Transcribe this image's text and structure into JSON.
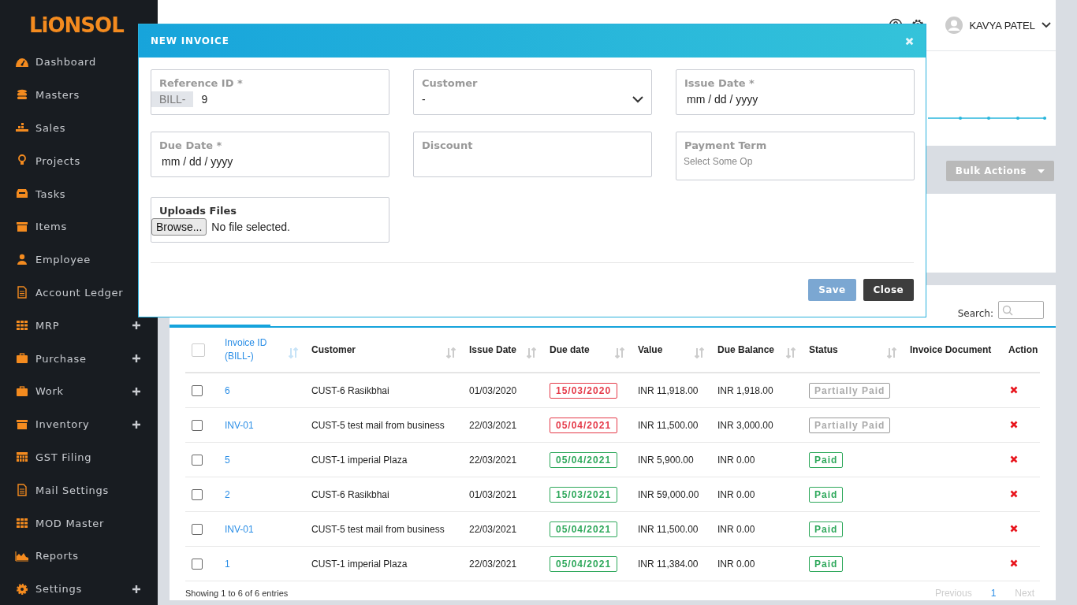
{
  "logo": "LiONSOL",
  "sidebar": {
    "items": [
      {
        "label": "Dashboard",
        "expandable": false
      },
      {
        "label": "Masters",
        "expandable": false
      },
      {
        "label": "Sales",
        "expandable": false
      },
      {
        "label": "Projects",
        "expandable": false
      },
      {
        "label": "Tasks",
        "expandable": false
      },
      {
        "label": "Items",
        "expandable": false
      },
      {
        "label": "Employee",
        "expandable": false
      },
      {
        "label": "Account Ledger",
        "expandable": false
      },
      {
        "label": "MRP",
        "expandable": true
      },
      {
        "label": "Purchase",
        "expandable": true
      },
      {
        "label": "Work",
        "expandable": true
      },
      {
        "label": "Inventory",
        "expandable": true
      },
      {
        "label": "GST Filing",
        "expandable": false
      },
      {
        "label": "Mail Settings",
        "expandable": false
      },
      {
        "label": "MOD Master",
        "expandable": false
      },
      {
        "label": "Reports",
        "expandable": false
      },
      {
        "label": "Settings",
        "expandable": true
      }
    ]
  },
  "header": {
    "user": "KAVYA PATEL"
  },
  "toolbar": {
    "bulk_actions": "Bulk Actions"
  },
  "table": {
    "search_label": "Search:",
    "columns": [
      {
        "label": "Invoice ID\n(BILL-)",
        "sortable": true,
        "link": true
      },
      {
        "label": "Customer",
        "sortable": true,
        "link": false
      },
      {
        "label": "Issue Date",
        "sortable": true,
        "link": false
      },
      {
        "label": "Due date",
        "sortable": true,
        "link": false
      },
      {
        "label": "Value",
        "sortable": true,
        "link": false
      },
      {
        "label": "Due Balance",
        "sortable": true,
        "link": false
      },
      {
        "label": "Status",
        "sortable": true,
        "link": false
      },
      {
        "label": "Invoice Document",
        "sortable": false,
        "link": false
      },
      {
        "label": "Action",
        "sortable": false,
        "link": false
      }
    ],
    "select_all_checked": false,
    "rows": [
      {
        "checked": false,
        "invoice_id": "6",
        "customer": "CUST-6 Rasikbhai",
        "issue_date": "01/03/2020",
        "due_date": "15/03/2020",
        "overdue": true,
        "value": "INR 11,918.00",
        "due_balance": "INR 1,918.00",
        "status": "Partially Paid",
        "paid": false
      },
      {
        "checked": false,
        "invoice_id": "INV-01",
        "customer": "CUST-5 test mail from business",
        "issue_date": "22/03/2021",
        "due_date": "05/04/2021",
        "overdue": true,
        "value": "INR 11,500.00",
        "due_balance": "INR 3,000.00",
        "status": "Partially Paid",
        "paid": false
      },
      {
        "checked": false,
        "invoice_id": "5",
        "customer": "CUST-1 imperial Plaza",
        "issue_date": "22/03/2021",
        "due_date": "05/04/2021",
        "overdue": false,
        "value": "INR 5,900.00",
        "due_balance": "INR 0.00",
        "status": "Paid",
        "paid": true
      },
      {
        "checked": false,
        "invoice_id": "2",
        "customer": "CUST-6 Rasikbhai",
        "issue_date": "01/03/2021",
        "due_date": "15/03/2021",
        "overdue": false,
        "value": "INR 59,000.00",
        "due_balance": "INR 0.00",
        "status": "Paid",
        "paid": true
      },
      {
        "checked": false,
        "invoice_id": "INV-01",
        "customer": "CUST-5 test mail from business",
        "issue_date": "22/03/2021",
        "due_date": "05/04/2021",
        "overdue": false,
        "value": "INR 11,500.00",
        "due_balance": "INR 0.00",
        "status": "Paid",
        "paid": true
      },
      {
        "checked": false,
        "invoice_id": "1",
        "customer": "CUST-1 imperial Plaza",
        "issue_date": "22/03/2021",
        "due_date": "05/04/2021",
        "overdue": false,
        "value": "INR 11,384.00",
        "due_balance": "INR 0.00",
        "status": "Paid",
        "paid": true
      }
    ],
    "info": "Showing 1 to 6 of 6 entries",
    "pagination": [
      {
        "label": "Previous",
        "selected": false
      },
      {
        "label": "1",
        "selected": true
      },
      {
        "label": "Next",
        "selected": false
      }
    ]
  },
  "modal": {
    "title": "NEW INVOICE",
    "fields": [
      {
        "kind": "prefixed",
        "label": "Reference ID *",
        "prefix": "BILL-",
        "value": "9"
      },
      {
        "kind": "select",
        "label": "Customer",
        "value": "-"
      },
      {
        "kind": "date",
        "label": "Issue Date *",
        "value": "mm / dd / yyyy"
      },
      {
        "kind": "date",
        "label": "Due Date *",
        "value": "mm / dd / yyyy"
      },
      {
        "kind": "text",
        "label": "Discount"
      },
      {
        "kind": "multiselect",
        "label": "Payment Term",
        "placeholder": "Select Some Op"
      },
      {
        "kind": "file",
        "label": "Uploads Files",
        "button": "Browse...",
        "value": "No file selected."
      }
    ],
    "buttons": [
      {
        "label": "Save",
        "kind": "primary"
      },
      {
        "label": "Close",
        "kind": "dark"
      }
    ]
  }
}
